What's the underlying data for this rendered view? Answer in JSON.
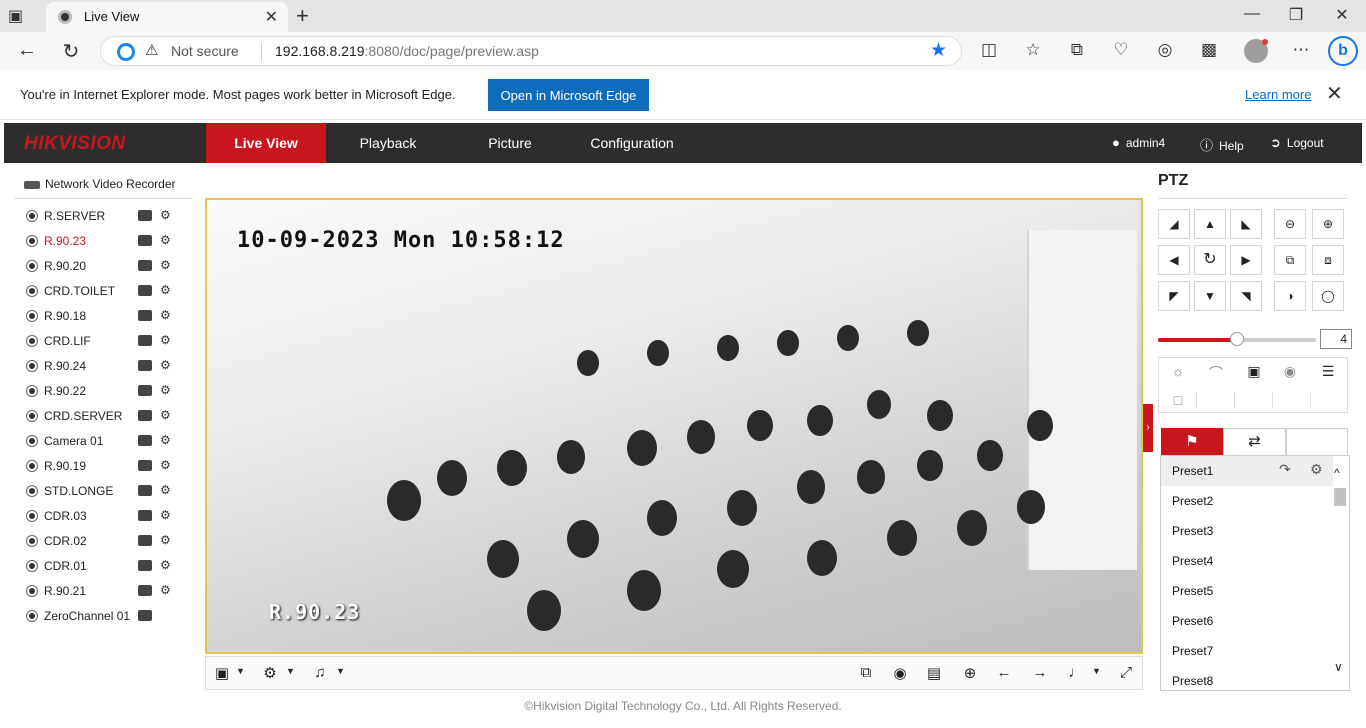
{
  "browser": {
    "tab_title": "Live View",
    "security_label": "Not secure",
    "url_host": "192.168.8.219",
    "url_rest": ":8080/doc/page/preview.asp",
    "ie_message": "You're in Internet Explorer mode. Most pages work better in Microsoft Edge.",
    "ie_open_button": "Open in Microsoft Edge",
    "ie_learn_more": "Learn more",
    "bing_label": "b"
  },
  "app": {
    "logo": "HIKVISION",
    "menu": [
      "Live View",
      "Playback",
      "Picture",
      "Configuration"
    ],
    "active_menu": "Live View",
    "user": "admin4",
    "help": "Help",
    "logout": "Logout",
    "accent_color": "#c8161d"
  },
  "device_tree": {
    "root_label": "Network Video Recorder",
    "cameras": [
      {
        "name": "R.SERVER",
        "active": false
      },
      {
        "name": "R.90.23",
        "active": true
      },
      {
        "name": "R.90.20",
        "active": false
      },
      {
        "name": "CRD.TOILET",
        "active": false
      },
      {
        "name": "R.90.18",
        "active": false
      },
      {
        "name": "CRD.LIF",
        "active": false
      },
      {
        "name": "R.90.24",
        "active": false
      },
      {
        "name": "R.90.22",
        "active": false
      },
      {
        "name": "CRD.SERVER",
        "active": false
      },
      {
        "name": "Camera 01",
        "active": false
      },
      {
        "name": "R.90.19",
        "active": false
      },
      {
        "name": "STD.LONGE",
        "active": false
      },
      {
        "name": "CDR.03",
        "active": false
      },
      {
        "name": "CDR.02",
        "active": false
      },
      {
        "name": "CDR.01",
        "active": false
      },
      {
        "name": "R.90.21",
        "active": false
      },
      {
        "name": "ZeroChannel 01",
        "active": false
      }
    ]
  },
  "video": {
    "timestamp": "10-09-2023 Mon 10:58:12",
    "camera_overlay": "R.90.23"
  },
  "ptz": {
    "title": "PTZ",
    "speed": "4",
    "speed_fraction": 0.5,
    "presets": [
      "Preset1",
      "Preset2",
      "Preset3",
      "Preset4",
      "Preset5",
      "Preset6",
      "Preset7",
      "Preset8"
    ]
  },
  "footer": {
    "copyright": "©Hikvision Digital Technology Co., Ltd. All Rights Reserved."
  }
}
